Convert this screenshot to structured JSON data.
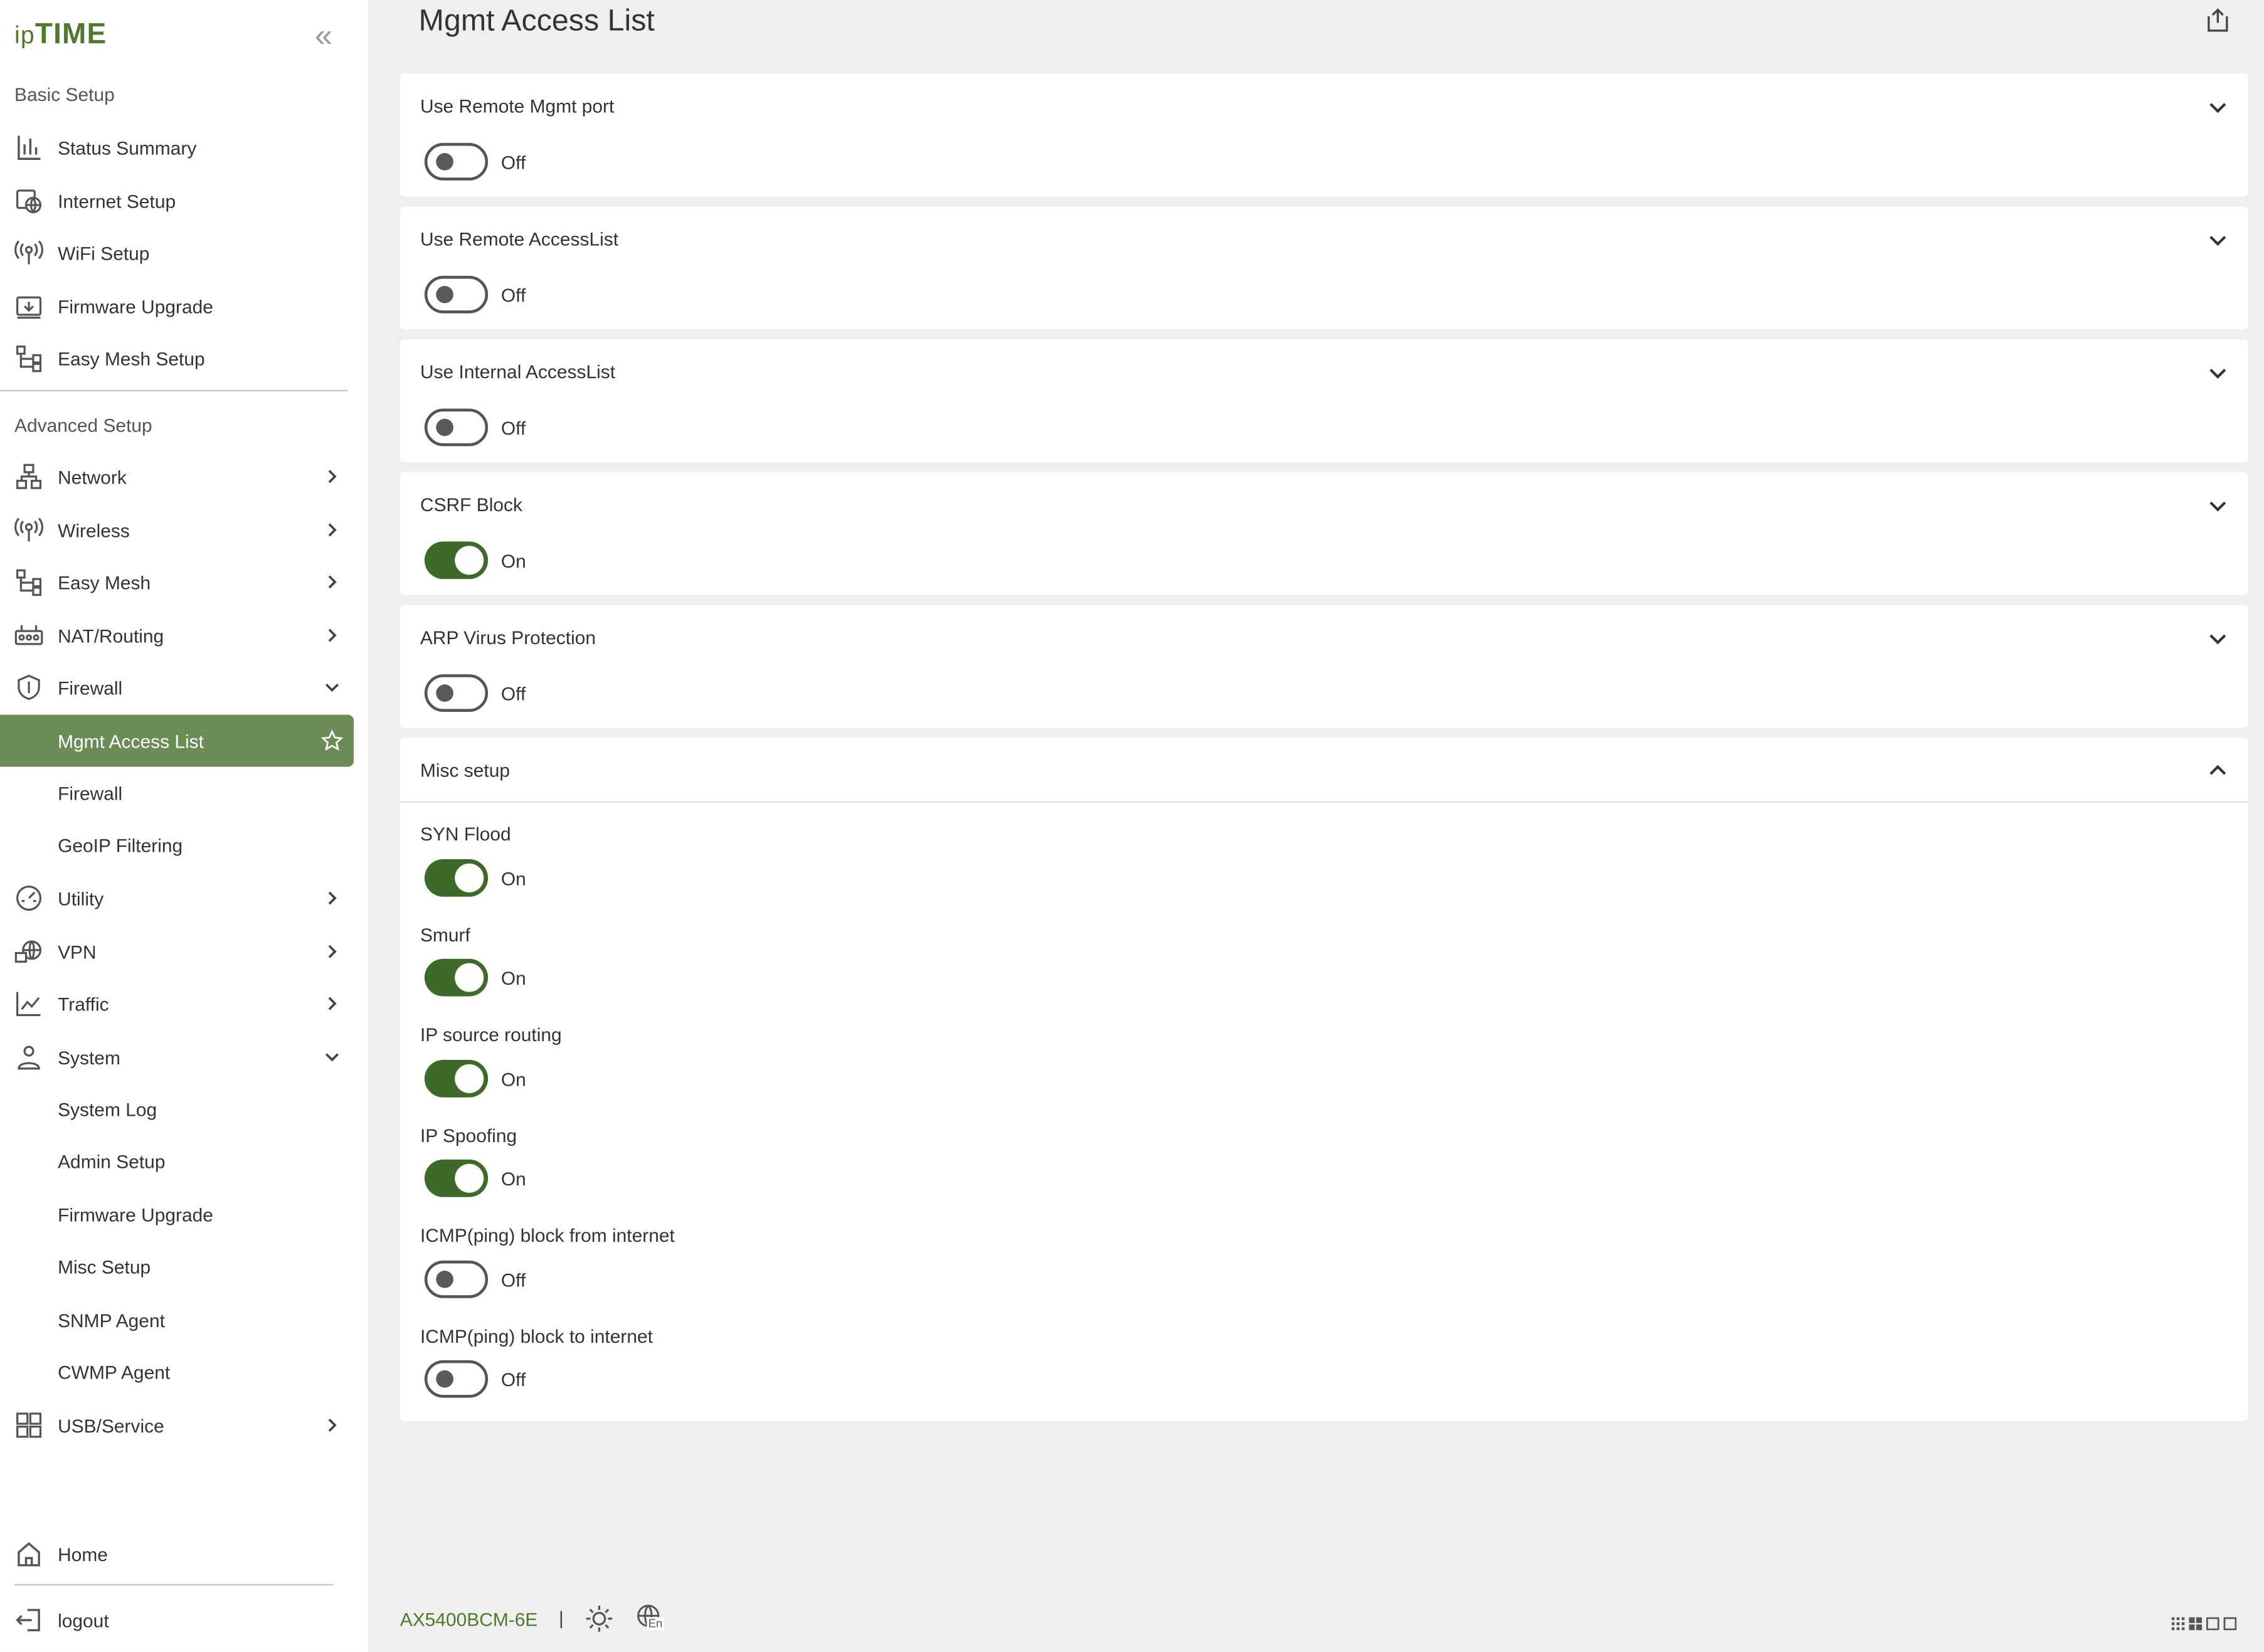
{
  "brand": {
    "logo_prefix": "ip",
    "logo_main": "TIME"
  },
  "sidebar": {
    "basic_title": "Basic Setup",
    "basic_items": [
      {
        "label": "Status Summary",
        "icon": "bar-chart-icon"
      },
      {
        "label": "Internet Setup",
        "icon": "internet-icon"
      },
      {
        "label": "WiFi Setup",
        "icon": "wifi-icon"
      },
      {
        "label": "Firmware Upgrade",
        "icon": "firmware-icon"
      },
      {
        "label": "Easy Mesh Setup",
        "icon": "mesh-icon"
      }
    ],
    "advanced_title": "Advanced Setup",
    "advanced_items": [
      {
        "label": "Network",
        "icon": "network-icon"
      },
      {
        "label": "Wireless",
        "icon": "wifi-icon"
      },
      {
        "label": "Easy Mesh",
        "icon": "mesh-icon"
      },
      {
        "label": "NAT/Routing",
        "icon": "router-icon"
      },
      {
        "label": "Firewall",
        "icon": "shield-icon"
      }
    ],
    "firewall_sub": {
      "active": "Mgmt Access List",
      "items": [
        "Firewall",
        "GeoIP Filtering"
      ]
    },
    "more_items": [
      {
        "label": "Utility",
        "icon": "gauge-icon"
      },
      {
        "label": "VPN",
        "icon": "vpn-icon"
      },
      {
        "label": "Traffic",
        "icon": "traffic-icon"
      },
      {
        "label": "System",
        "icon": "system-icon"
      }
    ],
    "system_sub": [
      "System Log",
      "Admin Setup",
      "Firmware Upgrade",
      "Misc Setup",
      "SNMP Agent",
      "CWMP Agent"
    ],
    "usb_item": {
      "label": "USB/Service",
      "icon": "grid-icon"
    },
    "home_label": "Home",
    "logout_label": "logout"
  },
  "main": {
    "title": "Mgmt Access List",
    "cards": [
      {
        "title": "Use Remote Mgmt port",
        "state": "Off"
      },
      {
        "title": "Use Remote AccessList",
        "state": "Off"
      },
      {
        "title": "Use Internal AccessList",
        "state": "Off"
      },
      {
        "title": "CSRF Block",
        "state": "On"
      },
      {
        "title": "ARP Virus Protection",
        "state": "Off"
      }
    ],
    "misc": {
      "title": "Misc setup",
      "items": [
        {
          "label": "SYN Flood",
          "state": "On"
        },
        {
          "label": "Smurf",
          "state": "On"
        },
        {
          "label": "IP source routing",
          "state": "On"
        },
        {
          "label": "IP Spoofing",
          "state": "On"
        },
        {
          "label": "ICMP(ping) block from internet",
          "state": "Off"
        },
        {
          "label": "ICMP(ping) block to internet",
          "state": "Off"
        }
      ]
    }
  },
  "footer": {
    "model": "AX5400BCM-6E",
    "separator": "|",
    "lang_badge": "En"
  },
  "colors": {
    "accent": "#3d6a28",
    "active_bg": "#6b8c55",
    "brand_text": "#4f7a2e"
  }
}
